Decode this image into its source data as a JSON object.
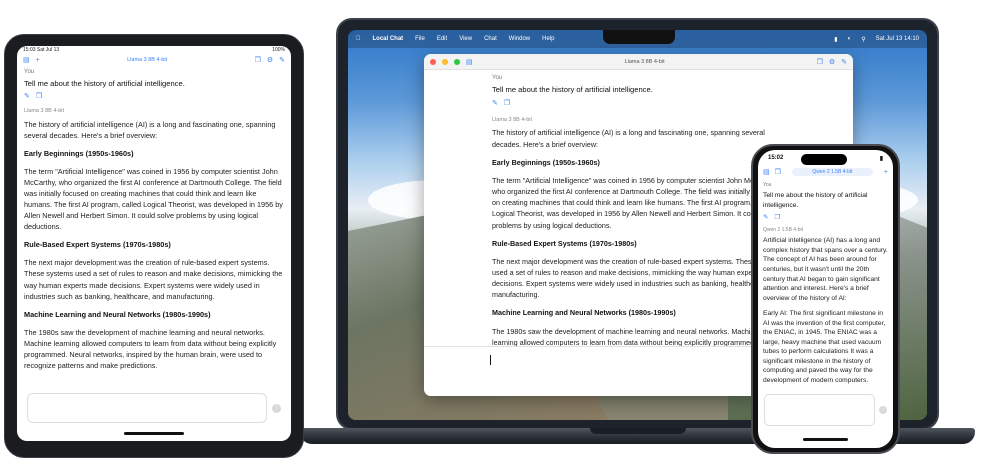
{
  "mac": {
    "menubar": {
      "app": "Local Chat",
      "items": [
        "File",
        "Edit",
        "View",
        "Chat",
        "Window",
        "Help"
      ],
      "clock": "Sat Jul 13  14:10"
    },
    "window_title": "Llama 3 8B 4-bit",
    "chat": {
      "you_label": "You",
      "prompt": "Tell me about the history of artificial intelligence.",
      "model_label": "Llama 3 8B 4-bit",
      "intro": "The history of artificial intelligence (AI) is a long and fascinating one, spanning several decades. Here's a brief overview:",
      "h1": "Early Beginnings (1950s-1960s)",
      "p1": "The term \"Artificial Intelligence\" was coined in 1956 by computer scientist John McCarthy, who organized the first AI conference at Dartmouth College. The field was initially focused on creating machines that could think and learn like humans. The first AI program, called Logical Theorist, was developed in 1956 by Allen Newell and Herbert Simon. It could solve problems by using logical deductions.",
      "h2": "Rule-Based Expert Systems (1970s-1980s)",
      "p2": "The next major development was the creation of rule-based expert systems. These systems used a set of rules to reason and make decisions, mimicking the way human experts made decisions. Expert systems were widely used in industries such as banking, healthcare, and manufacturing.",
      "h3": "Machine Learning and Neural Networks (1980s-1990s)",
      "p3": "The 1980s saw the development of machine learning and neural networks. Machine learning allowed computers to learn from data without being explicitly programmed. Neural networks, inspired by the human brain, were used to recognize patterns and make predictions."
    }
  },
  "ipad": {
    "status_time": "15:03  Sat Jul 13",
    "status_right": "100%",
    "nav_title": "Llama 3 8B 4-bit",
    "chat": {
      "you_label": "You",
      "prompt": "Tell me about the history of artificial intelligence.",
      "model_label": "Llama 3 8B 4-bit",
      "intro": "The history of artificial intelligence (AI) is a long and fascinating one, spanning several decades. Here's a brief overview:",
      "h1": "Early Beginnings (1950s-1960s)",
      "p1": "The term \"Artificial Intelligence\" was coined in 1956 by computer scientist John McCarthy, who organized the first AI conference at Dartmouth College. The field was initially focused on creating machines that could think and learn like humans. The first AI program, called Logical Theorist, was developed in 1956 by Allen Newell and Herbert Simon. It could solve problems by using logical deductions.",
      "h2": "Rule-Based Expert Systems (1970s-1980s)",
      "p2": "The next major development was the creation of rule-based expert systems. These systems used a set of rules to reason and make decisions, mimicking the way human experts made decisions. Expert systems were widely used in industries such as banking, healthcare, and manufacturing.",
      "h3": "Machine Learning and Neural Networks (1980s-1990s)",
      "p3": "The 1980s saw the development of machine learning and neural networks. Machine learning allowed computers to learn from data without being explicitly programmed. Neural networks, inspired by the human brain, were used to recognize patterns and make predictions."
    }
  },
  "iphone": {
    "status_time": "15:02",
    "nav_title": "Qwen 2 1.5B 4-bit",
    "chat": {
      "you_label": "You",
      "prompt": "Tell me about the history of artificial intelligence.",
      "model_label": "Qwen 2 1.5B 4-bit",
      "p1": "Artificial intelligence (AI) has a long and complex history that spans over a century. The concept of AI has been around for centuries, but it wasn't until the 20th century that AI began to gain significant attention and interest. Here's a brief overview of the history of AI:",
      "p2": "Early AI: The first significant milestone in AI was the invention of the first computer, the ENIAC, in 1945. The ENIAC was a large, heavy machine that used vacuum tubes to perform calculations It was a significant milestone in the history of computing and paved the way for the development of modern computers."
    }
  }
}
